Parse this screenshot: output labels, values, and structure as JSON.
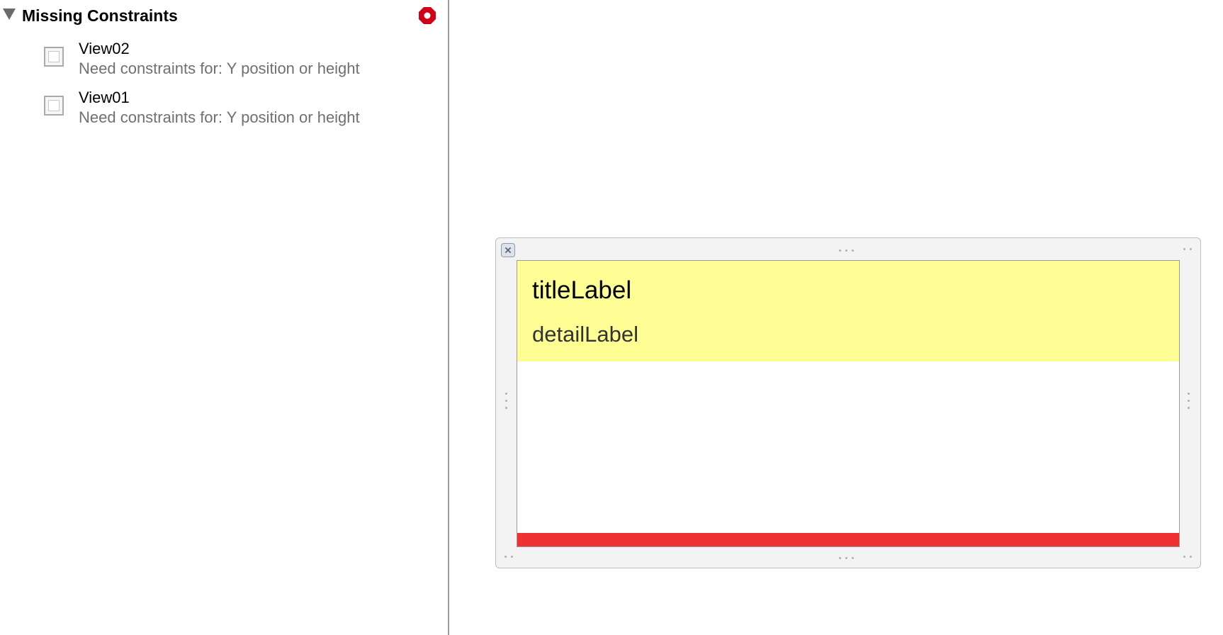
{
  "issues_panel": {
    "section_title": "Missing Constraints",
    "items": [
      {
        "name": "View02",
        "description": "Need constraints for: Y position or height"
      },
      {
        "name": "View01",
        "description": "Need constraints for: Y position or height"
      }
    ]
  },
  "canvas": {
    "title_label": "titleLabel",
    "detail_label": "detailLabel"
  },
  "colors": {
    "error": "#d0021b",
    "yellow_view": "#fffe94",
    "red_view": "#ef3131"
  }
}
